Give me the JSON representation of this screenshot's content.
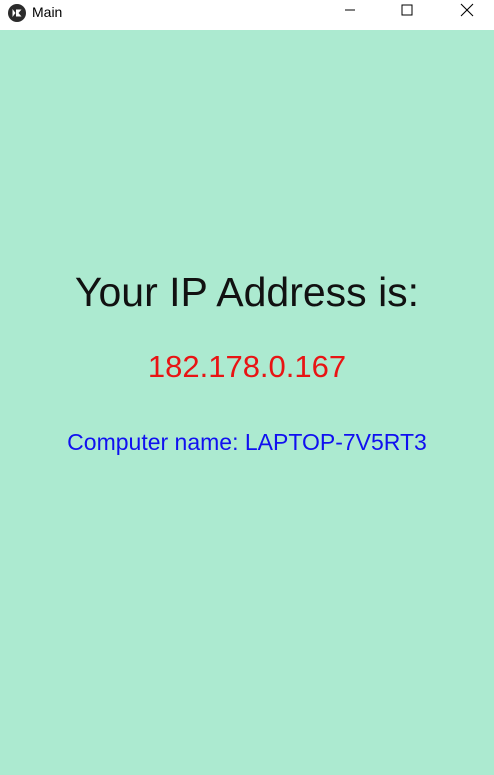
{
  "window": {
    "title": "Main",
    "app_icon": "kivy-logo-icon",
    "controls": {
      "minimize_icon": "minimize-icon",
      "maximize_icon": "maximize-icon",
      "close_icon": "close-icon"
    }
  },
  "main": {
    "heading": "Your IP Address is:",
    "ip_address": "182.178.0.167",
    "computer_name": "Computer name: LAPTOP-7V5RT3"
  },
  "colors": {
    "background": "#acead0",
    "heading": "#111111",
    "ip_address": "#e81414",
    "computer_name": "#1010f0"
  }
}
